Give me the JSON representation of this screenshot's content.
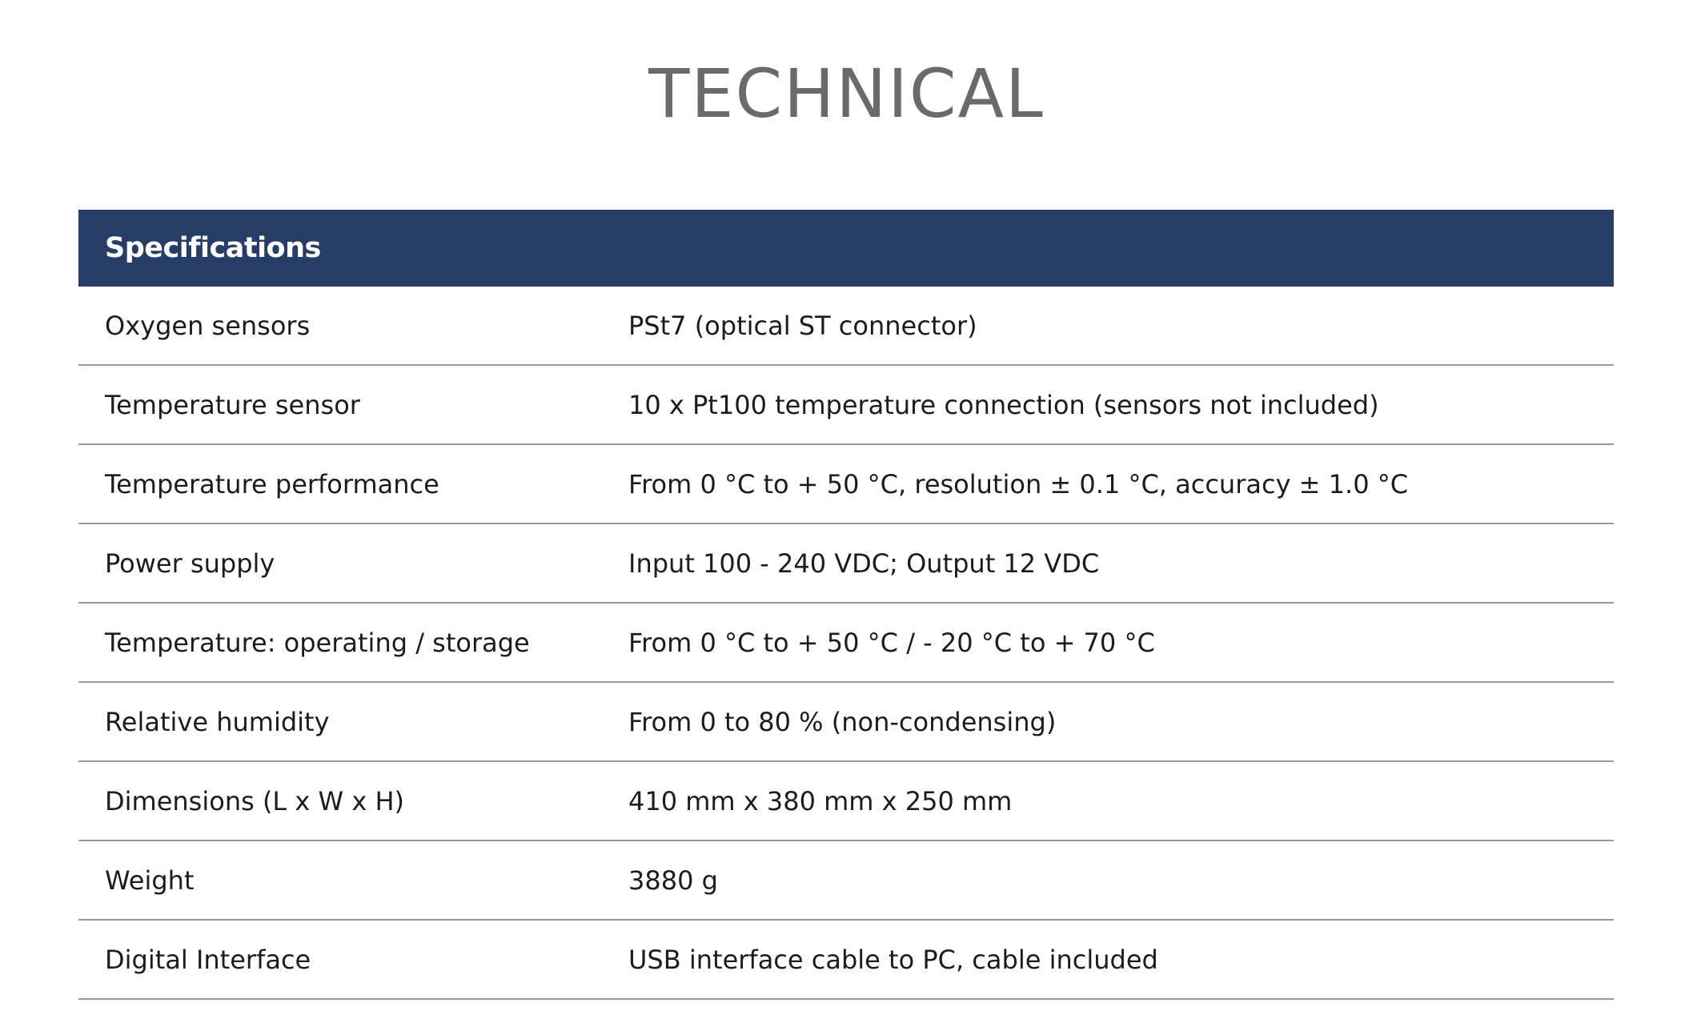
{
  "page": {
    "title": "TECHNICAL"
  },
  "table": {
    "header": "Specifications",
    "rows": [
      {
        "label": "Oxygen sensors",
        "value": "PSt7 (optical ST connector)"
      },
      {
        "label": "Temperature sensor",
        "value": "10 x Pt100 temperature connection (sensors not included)"
      },
      {
        "label": "Temperature performance",
        "value": "From 0 °C to + 50 °C, resolution  ± 0.1  °C, accuracy  ± 1.0  °C"
      },
      {
        "label": "Power supply",
        "value": "Input 100 - 240 VDC; Output 12 VDC"
      },
      {
        "label": "Temperature: operating / storage",
        "value": "From 0 °C to + 50  °C / - 20  °C to + 70  °C"
      },
      {
        "label": "Relative humidity",
        "value": "From 0 to 80 % (non-condensing)"
      },
      {
        "label": "Dimensions (L x W x H)",
        "value": "410 mm x 380 mm x 250 mm"
      },
      {
        "label": "Weight",
        "value": "3880 g"
      },
      {
        "label": "Digital Interface",
        "value": "USB interface cable to PC, cable included"
      }
    ]
  },
  "colors": {
    "header_bg": "#263d68",
    "title_text": "#6a6a6a",
    "divider": "#9a9a9a"
  }
}
